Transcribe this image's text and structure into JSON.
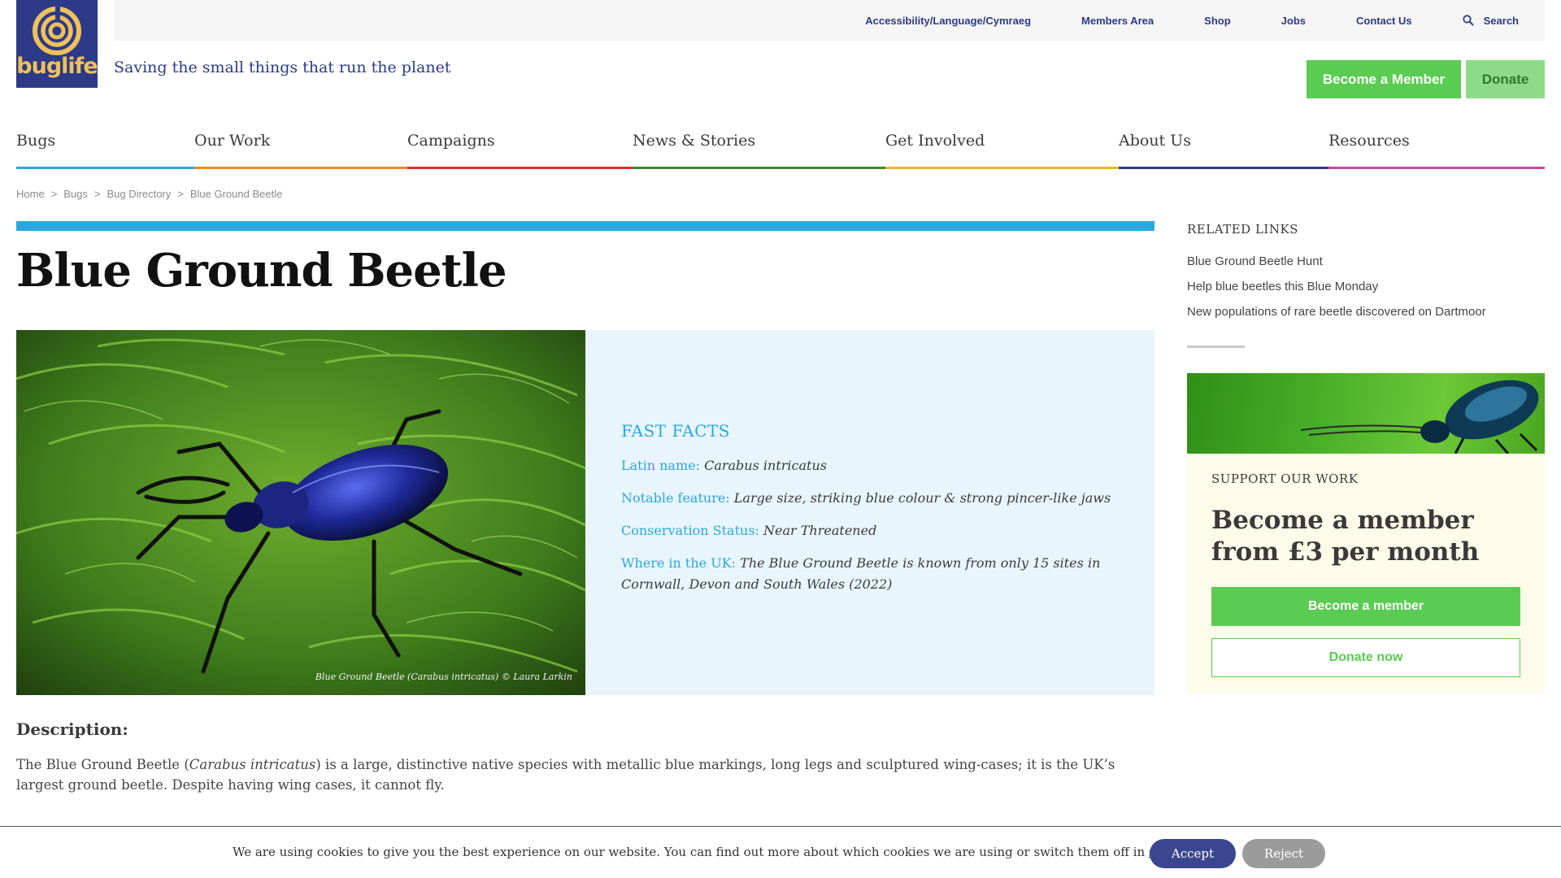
{
  "header": {
    "logo_text": "buglife",
    "tagline": "Saving the small things that run the planet",
    "top_links": [
      "Accessibility/Language/Cymraeg",
      "Members Area",
      "Shop",
      "Jobs",
      "Contact Us"
    ],
    "search_label": "Search",
    "become_member_label": "Become a Member",
    "donate_label": "Donate"
  },
  "nav": {
    "items": [
      {
        "label": "Bugs",
        "color": "#2aa7e0"
      },
      {
        "label": "Our Work",
        "color": "#f08a24"
      },
      {
        "label": "Campaigns",
        "color": "#e03030"
      },
      {
        "label": "News & Stories",
        "color": "#3a8a2a"
      },
      {
        "label": "Get Involved",
        "color": "#f2b52a"
      },
      {
        "label": "About Us",
        "color": "#2c3a87"
      },
      {
        "label": "Resources",
        "color": "#c04a9a"
      }
    ]
  },
  "breadcrumb": [
    "Home",
    ">",
    "Bugs",
    ">",
    "Bug Directory",
    ">",
    "Blue Ground Beetle"
  ],
  "page": {
    "title": "Blue Ground Beetle",
    "photo_caption": "Blue Ground Beetle (Carabus intricatus) © Laura Larkin",
    "facts": {
      "heading": "FAST FACTS",
      "items": [
        {
          "key": "Latin name:",
          "value": "Carabus intricatus"
        },
        {
          "key": "Notable feature:",
          "value": "Large size, striking blue colour & strong pincer-like jaws"
        },
        {
          "key": "Conservation Status:",
          "value": "Near Threatened"
        },
        {
          "key": "Where in the UK:",
          "value": "The Blue Ground Beetle is known from only 15 sites in Cornwall, Devon and South Wales (2022)"
        }
      ]
    },
    "description_heading": "Description:",
    "description_part1": "The Blue Ground Beetle (",
    "description_italic": "Carabus intricatus",
    "description_part2": ") is a large, distinctive native species with metallic blue markings, long legs and sculptured wing-cases; it is the UK’s largest ground beetle.  Despite having wing cases, it cannot fly."
  },
  "sidebar": {
    "related_title": "RELATED LINKS",
    "related_links": [
      "Blue Ground Beetle Hunt",
      "Help blue beetles this Blue Monday",
      "New populations of rare beetle discovered on Dartmoor"
    ],
    "support_label": "SUPPORT OUR WORK",
    "support_heading": "Become a member from £3 per month",
    "member_button": "Become a member",
    "donate_button": "Donate now"
  },
  "cookie": {
    "text": "We are using cookies to give you the best experience on our website. You can find out more about which cookies we are using or switch them off in ",
    "settings_link": "settings",
    "period": ".",
    "accept": "Accept",
    "reject": "Reject"
  }
}
